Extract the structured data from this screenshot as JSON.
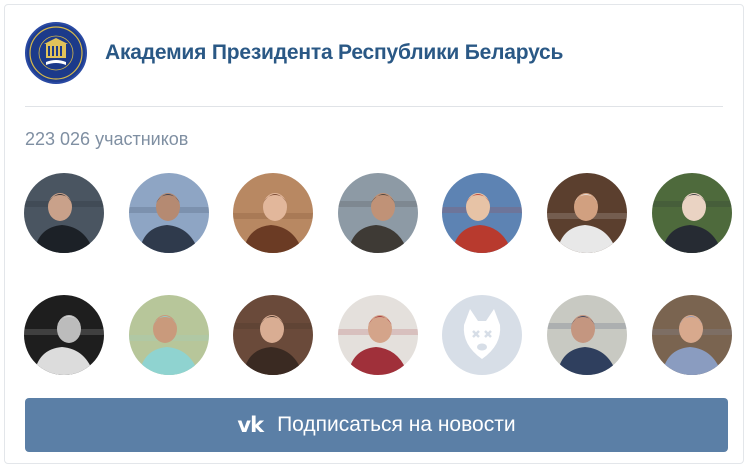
{
  "group": {
    "name": "Академия Президента Республики Беларусь"
  },
  "members": {
    "count_text": "223 026 участников"
  },
  "subscribe_button": {
    "icon": "vk-logo-icon",
    "icon_text": "vk",
    "label": "Подписаться на новости"
  },
  "colors": {
    "accent": "#5b7fa6",
    "group_name": "#2a5885",
    "muted_text": "#7f8fa2",
    "placeholder_avatar": "#d7dee7"
  },
  "avatars": [
    {
      "kind": "photo",
      "bg": "#4a5561",
      "fg": "#1c2127",
      "skin": "#c9a18a"
    },
    {
      "kind": "photo",
      "bg": "#8ea5c4",
      "fg": "#2f3a4c",
      "skin": "#b58a72"
    },
    {
      "kind": "photo",
      "bg": "#b88862",
      "fg": "#6b3b24",
      "skin": "#e2b79b"
    },
    {
      "kind": "photo",
      "bg": "#8d9aa5",
      "fg": "#3e3a35",
      "skin": "#c09277"
    },
    {
      "kind": "photo",
      "bg": "#5d83b3",
      "fg": "#b83a2e",
      "skin": "#e7c3a6"
    },
    {
      "kind": "photo",
      "bg": "#5b3f2e",
      "fg": "#e8e8e8",
      "skin": "#d1a080"
    },
    {
      "kind": "photo",
      "bg": "#4e6a3c",
      "fg": "#262b33",
      "skin": "#ead3c3"
    },
    {
      "kind": "photo",
      "bg": "#1e1e1e",
      "fg": "#dcdcdc",
      "skin": "#bcbcbc"
    },
    {
      "kind": "photo",
      "bg": "#b7c69a",
      "fg": "#8fd3d0",
      "skin": "#c99a7c"
    },
    {
      "kind": "photo",
      "bg": "#6a4a3a",
      "fg": "#3a2a22",
      "skin": "#d9ad93"
    },
    {
      "kind": "photo",
      "bg": "#e4e0dc",
      "fg": "#a0303a",
      "skin": "#d4a48a"
    },
    {
      "kind": "placeholder",
      "bg": "#d7dee7",
      "fg": "#ffffff",
      "skin": "#ffffff"
    },
    {
      "kind": "photo",
      "bg": "#c8c9c2",
      "fg": "#2f3f5e",
      "skin": "#c49680"
    },
    {
      "kind": "photo",
      "bg": "#7a6450",
      "fg": "#8a9cc0",
      "skin": "#d8a98d"
    }
  ]
}
